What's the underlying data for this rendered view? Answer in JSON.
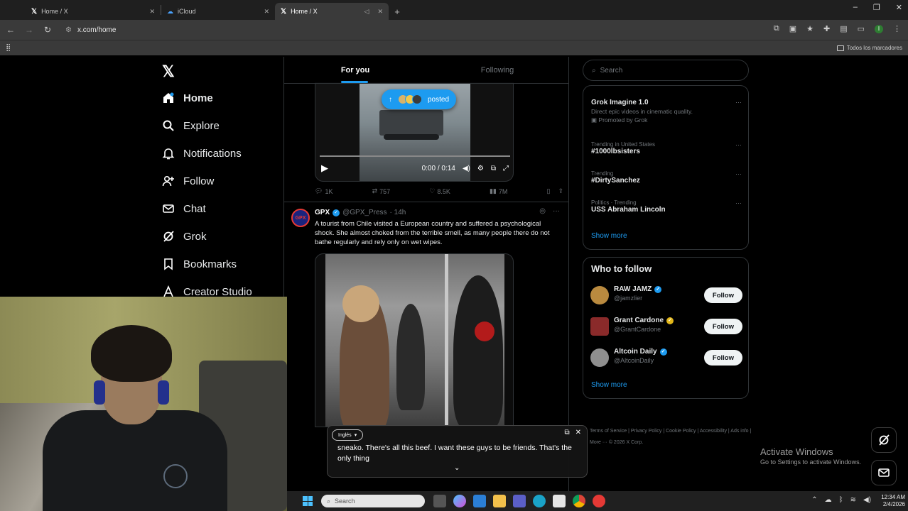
{
  "browser": {
    "tabs": [
      {
        "label": "Home / X",
        "active": false
      },
      {
        "label": "iCloud",
        "active": false
      },
      {
        "label": "Home / X",
        "active": true
      }
    ],
    "new_tab": "+",
    "url": "x.com/home",
    "bookmarks_all": "Todos los marcadores"
  },
  "nav": {
    "items": [
      {
        "label": "Home",
        "icon": "home-icon"
      },
      {
        "label": "Explore",
        "icon": "search-icon"
      },
      {
        "label": "Notifications",
        "icon": "bell-icon"
      },
      {
        "label": "Follow",
        "icon": "person-plus-icon"
      },
      {
        "label": "Chat",
        "icon": "mail-icon"
      },
      {
        "label": "Grok",
        "icon": "grok-icon"
      },
      {
        "label": "Bookmarks",
        "icon": "bookmark-icon"
      },
      {
        "label": "Creator Studio",
        "icon": "creator-icon"
      }
    ]
  },
  "feed": {
    "tab_for_you": "For you",
    "tab_following": "Following",
    "posted_pill": "posted",
    "video1": {
      "time": "0:00 / 0:14"
    },
    "post1_actions": {
      "replies": "1K",
      "reposts": "757",
      "likes": "8.5K",
      "views": "7M"
    },
    "post2": {
      "name": "GPX",
      "handle": "@GPX_Press",
      "time": "· 14h",
      "text": "A tourist from Chile visited a European country and suffered a psychological shock. She almost choked from the terrible smell, as many people there do not bathe regularly and rely only on wet wipes."
    }
  },
  "right": {
    "search_placeholder": "Search",
    "trends": [
      {
        "meta": "",
        "title": "Grok Imagine 1.0",
        "desc": "Direct epic videos in cinematic quality.",
        "promo": "Promoted by Grok"
      },
      {
        "meta": "Trending in United States",
        "title": "#1000lbsisters",
        "desc": "",
        "promo": ""
      },
      {
        "meta": "Trending",
        "title": "#DirtySanchez",
        "desc": "",
        "promo": ""
      },
      {
        "meta": "Politics · Trending",
        "title": "USS Abraham Lincoln",
        "desc": "",
        "promo": ""
      }
    ],
    "show_more": "Show more",
    "who_to_follow_title": "Who to follow",
    "who_to_follow": [
      {
        "name": "RAW JAMZ",
        "handle": "@jamzlier",
        "badge": "blue"
      },
      {
        "name": "Grant Cardone",
        "handle": "@GrantCardone",
        "badge": "gold"
      },
      {
        "name": "Altcoin Daily",
        "handle": "@AltcoinDaily",
        "badge": "blue"
      }
    ],
    "follow_label": "Follow",
    "footer": "Terms of Service | Privacy Policy | Cookie Policy | Accessibility | Ads info | More ··· © 2026 X Corp."
  },
  "caption": {
    "language": "Inglés",
    "text": "sneako. There's all this beef. I want these guys to be friends. That's the only thing"
  },
  "windows": {
    "activate_title": "Activate Windows",
    "activate_sub": "Go to Settings to activate Windows.",
    "search": "Search",
    "time": "12:34 AM",
    "date": "2/4/2026"
  }
}
